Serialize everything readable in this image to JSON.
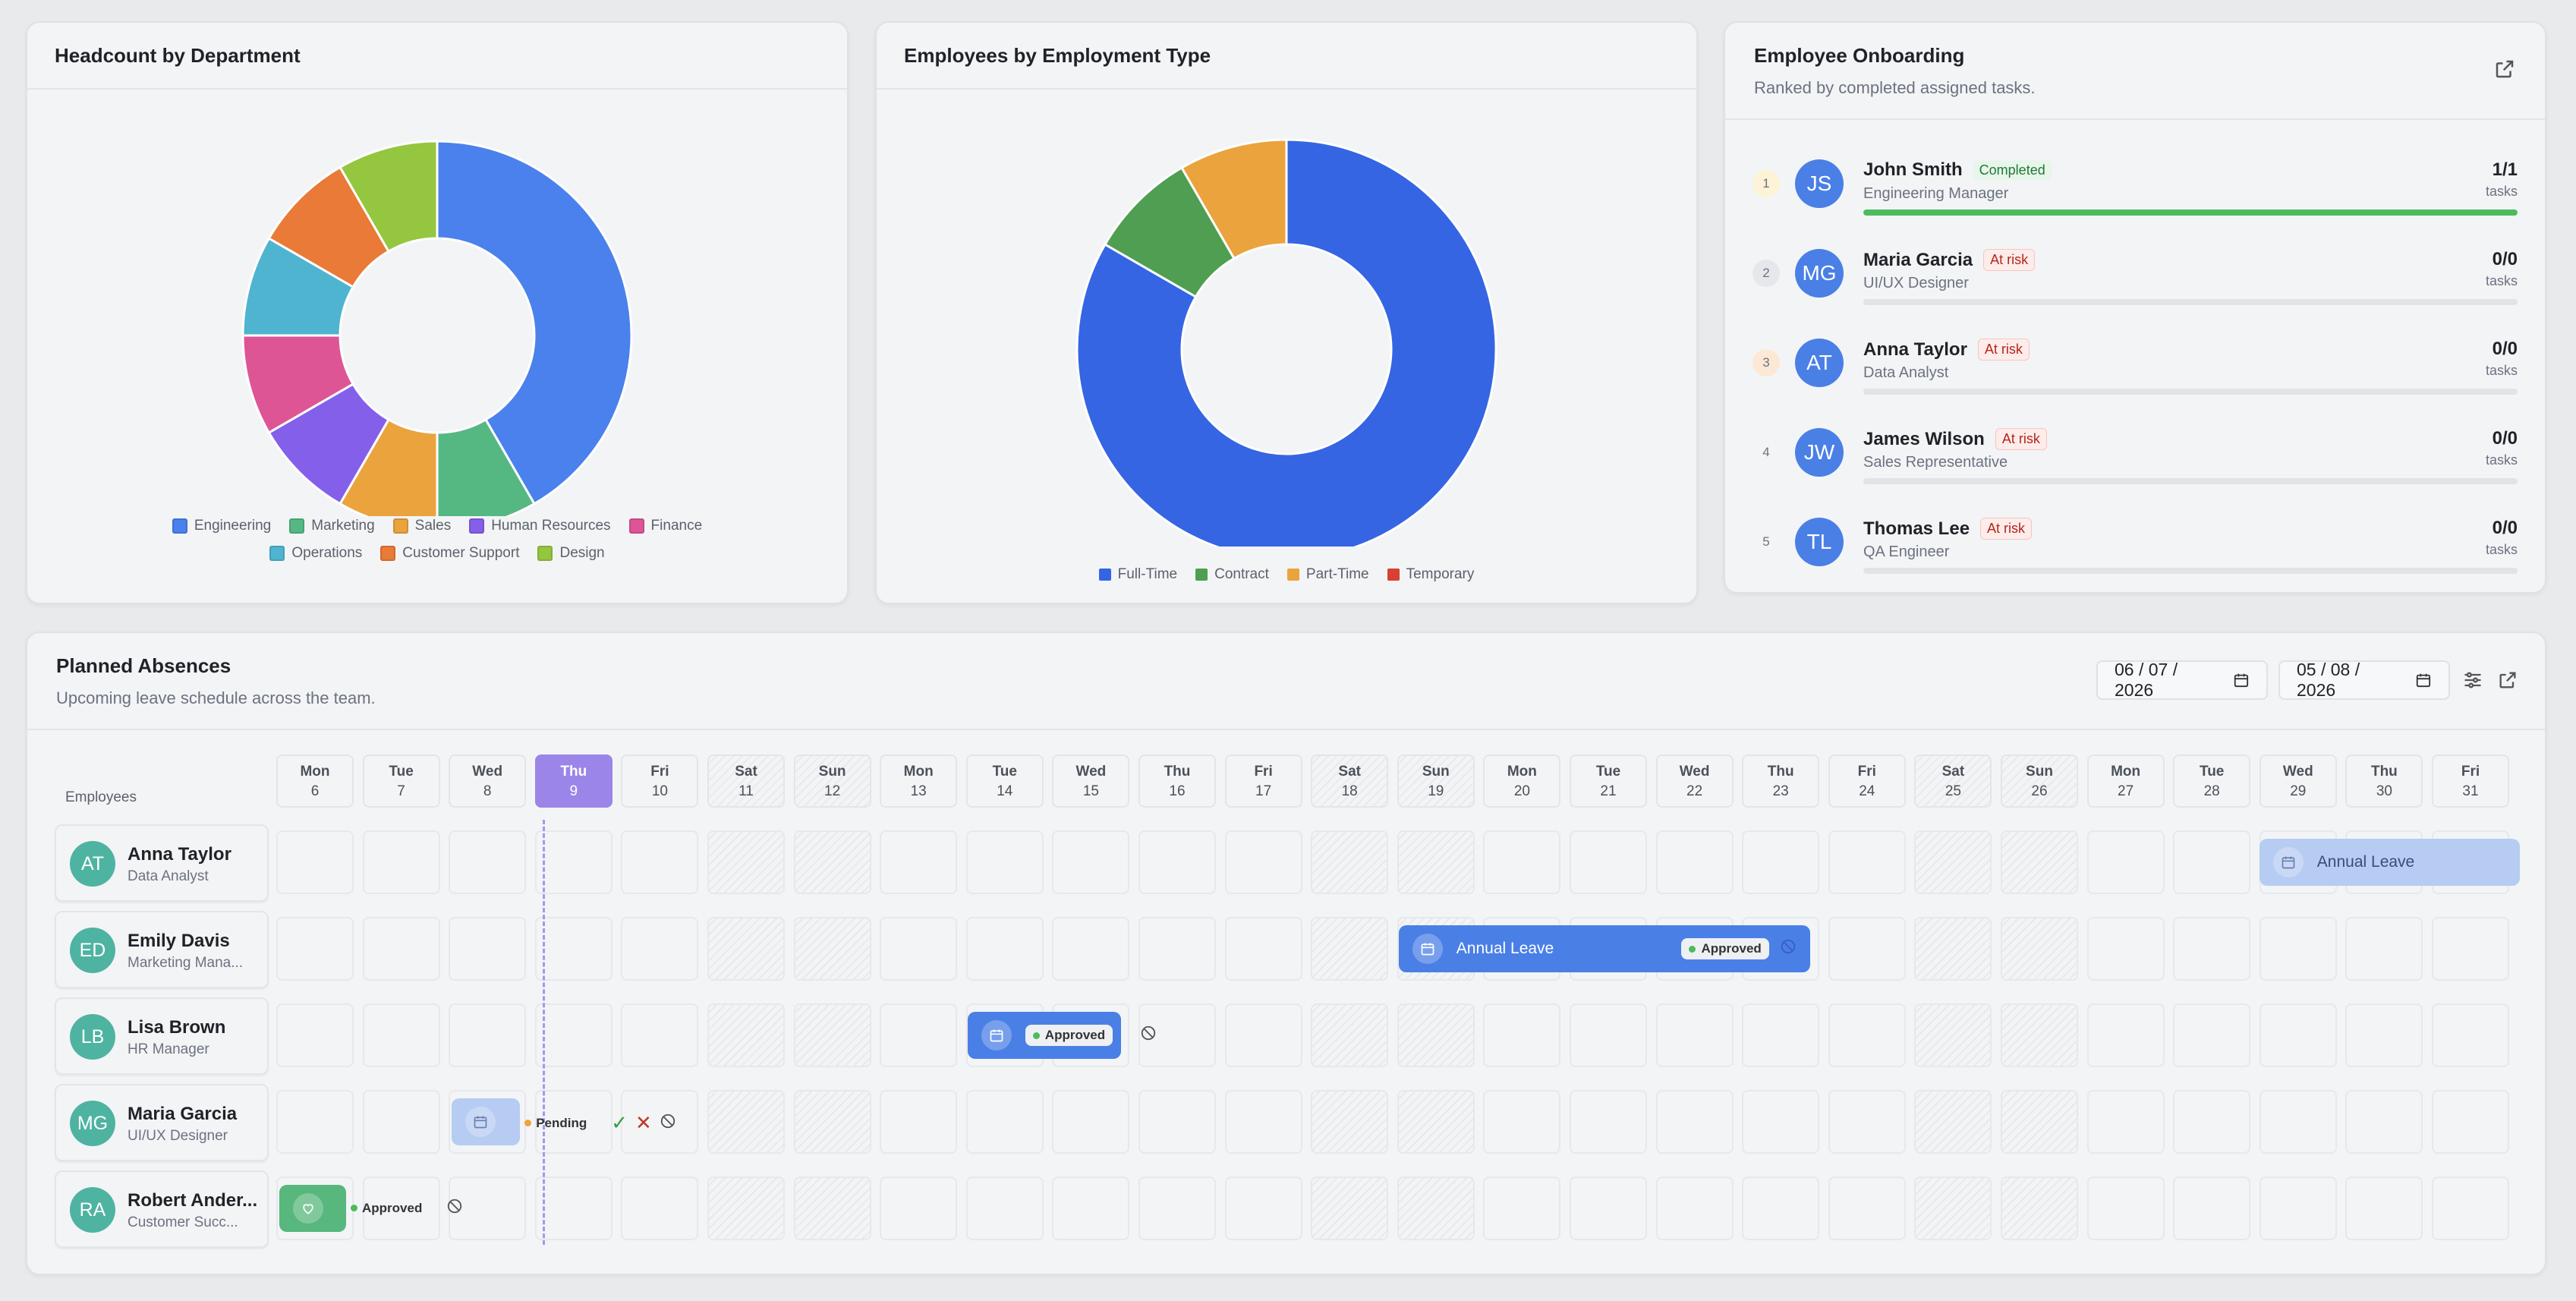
{
  "headcount": {
    "title": "Headcount by Department",
    "legend": [
      {
        "label": "Engineering",
        "color": "#4a81ec"
      },
      {
        "label": "Marketing",
        "color": "#55b883"
      },
      {
        "label": "Sales",
        "color": "#eba33e"
      },
      {
        "label": "Human Resources",
        "color": "#8460ea"
      },
      {
        "label": "Finance",
        "color": "#de5596"
      },
      {
        "label": "Operations",
        "color": "#4fb4d0"
      },
      {
        "label": "Customer Support",
        "color": "#ea7a38"
      },
      {
        "label": "Design",
        "color": "#95c63f"
      }
    ]
  },
  "employment_type": {
    "title": "Employees by Employment Type",
    "legend": [
      {
        "label": "Full-Time",
        "color": "#3565e3"
      },
      {
        "label": "Contract",
        "color": "#4f9e52"
      },
      {
        "label": "Part-Time",
        "color": "#eba33e"
      },
      {
        "label": "Temporary",
        "color": "#d84032"
      }
    ]
  },
  "chart_data": [
    {
      "type": "pie",
      "title": "Headcount by Department",
      "categories": [
        "Engineering",
        "Marketing",
        "Sales",
        "Human Resources",
        "Finance",
        "Operations",
        "Customer Support",
        "Design"
      ],
      "values": [
        5,
        1,
        1,
        1,
        1,
        1,
        1,
        1
      ],
      "donut": true,
      "legend_position": "bottom"
    },
    {
      "type": "pie",
      "title": "Employees by Employment Type",
      "categories": [
        "Full-Time",
        "Contract",
        "Part-Time",
        "Temporary"
      ],
      "values": [
        10,
        1,
        1,
        0
      ],
      "donut": true,
      "legend_position": "bottom"
    }
  ],
  "onboarding": {
    "title": "Employee Onboarding",
    "subtitle": "Ranked by completed assigned tasks.",
    "unit": "tasks",
    "rows": [
      {
        "rank": "1",
        "initials": "JS",
        "name": "John Smith",
        "role": "Engineering Manager",
        "badge": "Completed",
        "count": "1/1",
        "progress": 1.0
      },
      {
        "rank": "2",
        "initials": "MG",
        "name": "Maria Garcia",
        "role": "UI/UX Designer",
        "badge": "At risk",
        "count": "0/0",
        "progress": 0
      },
      {
        "rank": "3",
        "initials": "AT",
        "name": "Anna Taylor",
        "role": "Data Analyst",
        "badge": "At risk",
        "count": "0/0",
        "progress": 0
      },
      {
        "rank": "4",
        "initials": "JW",
        "name": "James Wilson",
        "role": "Sales Representative",
        "badge": "At risk",
        "count": "0/0",
        "progress": 0
      },
      {
        "rank": "5",
        "initials": "TL",
        "name": "Thomas Lee",
        "role": "QA Engineer",
        "badge": "At risk",
        "count": "0/0",
        "progress": 0
      }
    ]
  },
  "absences": {
    "title": "Planned Absences",
    "subtitle": "Upcoming leave schedule across the team.",
    "date_from": "06 / 07 / 2026",
    "date_to": "05 / 08 / 2026",
    "employees_label": "Employees",
    "days": [
      {
        "name": "Mon",
        "num": "6"
      },
      {
        "name": "Tue",
        "num": "7"
      },
      {
        "name": "Wed",
        "num": "8"
      },
      {
        "name": "Thu",
        "num": "9"
      },
      {
        "name": "Fri",
        "num": "10"
      },
      {
        "name": "Sat",
        "num": "11"
      },
      {
        "name": "Sun",
        "num": "12"
      },
      {
        "name": "Mon",
        "num": "13"
      },
      {
        "name": "Tue",
        "num": "14"
      },
      {
        "name": "Wed",
        "num": "15"
      },
      {
        "name": "Thu",
        "num": "16"
      },
      {
        "name": "Fri",
        "num": "17"
      },
      {
        "name": "Sat",
        "num": "18"
      },
      {
        "name": "Sun",
        "num": "19"
      },
      {
        "name": "Mon",
        "num": "20"
      },
      {
        "name": "Tue",
        "num": "21"
      },
      {
        "name": "Wed",
        "num": "22"
      },
      {
        "name": "Thu",
        "num": "23"
      },
      {
        "name": "Fri",
        "num": "24"
      },
      {
        "name": "Sat",
        "num": "25"
      },
      {
        "name": "Sun",
        "num": "26"
      },
      {
        "name": "Mon",
        "num": "27"
      },
      {
        "name": "Tue",
        "num": "28"
      },
      {
        "name": "Wed",
        "num": "29"
      },
      {
        "name": "Thu",
        "num": "30"
      },
      {
        "name": "Fri",
        "num": "31"
      }
    ],
    "employees": [
      {
        "initials": "AT",
        "name": "Anna Taylor",
        "role": "Data Analyst"
      },
      {
        "initials": "ED",
        "name": "Emily Davis",
        "role": "Marketing Mana..."
      },
      {
        "initials": "LB",
        "name": "Lisa Brown",
        "role": "HR Manager"
      },
      {
        "initials": "MG",
        "name": "Maria Garcia",
        "role": "UI/UX Designer"
      },
      {
        "initials": "RA",
        "name": "Robert Ander...",
        "role": "Customer Succ..."
      }
    ],
    "leaves": {
      "anna_label": "Annual Leave",
      "emily_label": "Annual Leave",
      "emily_status": "Approved",
      "lisa_status": "Approved",
      "maria_status": "Pending",
      "robert_status": "Approved"
    },
    "colors": {
      "approved_blue": "#4a7fe6",
      "light_blue": "#b7ccf2",
      "green": "#57b77d",
      "pending": "#f0a23b",
      "today": "#9b85e8"
    }
  }
}
